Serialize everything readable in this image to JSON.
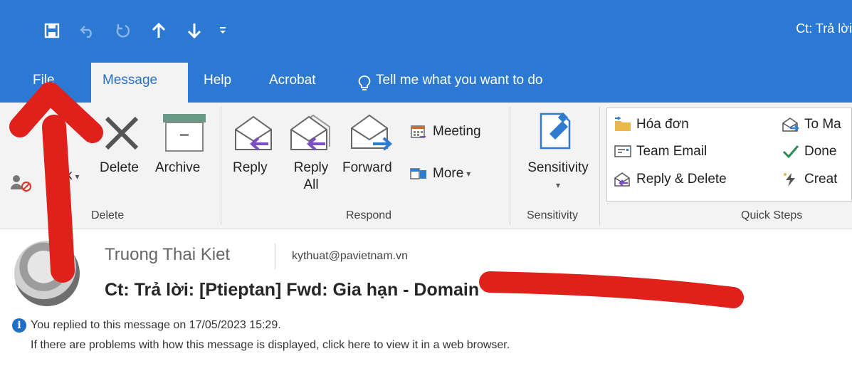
{
  "window": {
    "title": "Ct: Trả lời"
  },
  "quick_access": [
    {
      "name": "save-icon",
      "glyph": "🖫"
    },
    {
      "name": "undo-icon",
      "glyph": "↶"
    },
    {
      "name": "redo-icon",
      "glyph": "↻"
    },
    {
      "name": "up-arrow-icon",
      "glyph": "🡑"
    },
    {
      "name": "down-arrow-icon",
      "glyph": "🡓"
    },
    {
      "name": "customize-icon",
      "glyph": "⩡"
    }
  ],
  "tabs": {
    "file": "File",
    "message": "Message",
    "help": "Help",
    "acrobat": "Acrobat",
    "tell_me": "Tell me what you want to do"
  },
  "ribbon": {
    "delete_group": {
      "label": "Delete",
      "ignore_fragment": "k",
      "delete": "Delete",
      "archive": "Archive"
    },
    "respond_group": {
      "label": "Respond",
      "reply": "Reply",
      "reply_all_1": "Reply",
      "reply_all_2": "All",
      "forward": "Forward",
      "meeting": "Meeting",
      "more": "More"
    },
    "sensitivity_group": {
      "label": "Sensitivity",
      "button": "Sensitivity"
    },
    "quick_steps": {
      "label": "Quick Steps",
      "items_left": [
        "Hóa đơn",
        "Team Email",
        "Reply & Delete"
      ],
      "items_right": [
        "To Ma",
        "Done",
        "Creat"
      ]
    }
  },
  "message": {
    "sender": "Truong Thai Kiet",
    "email": "kythuat@pavietnam.vn",
    "subject": "Ct: Trả lời: [Ptieptan] Fwd: Gia hạn - Domain",
    "info_replied": "You replied to this message on 17/05/2023 15:29.",
    "info_browser": "If there are problems with how this message is displayed, click here to view it in a web browser."
  },
  "colors": {
    "brand_blue": "#2b79d2",
    "ribbon_bg": "#f3f3f3",
    "annotation_red": "#e0201b",
    "reply_purple": "#7a4fc4",
    "forward_blue": "#2f7bd0"
  }
}
